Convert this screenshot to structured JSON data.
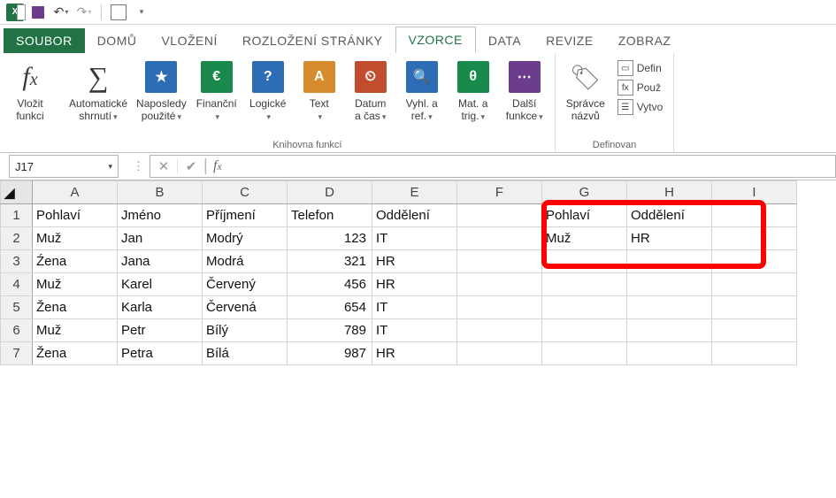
{
  "qat": {
    "undo": "↶",
    "redo": "↷"
  },
  "tabs": {
    "file": "SOUBOR",
    "home": "DOMŮ",
    "insert": "VLOŽENÍ",
    "layout": "ROZLOŽENÍ STRÁNKY",
    "formulas": "VZORCE",
    "data": "DATA",
    "review": "REVIZE",
    "view": "ZOBRAZ"
  },
  "ribbon": {
    "insert_fn": {
      "label": "Vložit\nfunkci"
    },
    "library_group": "Knihovna funkcí",
    "autosum": {
      "label": "Automatické\nshrnutí"
    },
    "recent": {
      "label": "Naposledy\npoužité",
      "icon": "★"
    },
    "financial": {
      "label": "Finanční",
      "icon": "€"
    },
    "logical": {
      "label": "Logické",
      "icon": "?"
    },
    "text": {
      "label": "Text",
      "icon": "A"
    },
    "date": {
      "label": "Datum\na čas",
      "icon": "⏲"
    },
    "lookup": {
      "label": "Vyhl. a\nref.",
      "icon": "🔍"
    },
    "math": {
      "label": "Mat. a\ntrig.",
      "icon": "θ"
    },
    "more": {
      "label": "Další\nfunkce",
      "icon": "⋯"
    },
    "names_group": "Definovan",
    "name_mgr": {
      "label": "Správce\nnázvů"
    },
    "def_name": "Defin",
    "use_in": "Použ",
    "create": "Vytvo"
  },
  "namebox": "J17",
  "formula": "",
  "cols": [
    "A",
    "B",
    "C",
    "D",
    "E",
    "F",
    "G",
    "H",
    "I"
  ],
  "rows": [
    {
      "n": "1",
      "c": [
        "Pohlaví",
        "Jméno",
        "Příjmení",
        "Telefon",
        "Oddělení",
        "",
        "Pohlaví",
        "Oddělení",
        ""
      ]
    },
    {
      "n": "2",
      "c": [
        "Muž",
        "Jan",
        "Modrý",
        "123",
        "IT",
        "",
        "Muž",
        "HR",
        ""
      ]
    },
    {
      "n": "3",
      "c": [
        "Źena",
        "Jana",
        "Modrá",
        "321",
        "HR",
        "",
        "",
        "",
        ""
      ]
    },
    {
      "n": "4",
      "c": [
        "Muž",
        "Karel",
        "Červený",
        "456",
        "HR",
        "",
        "",
        "",
        ""
      ]
    },
    {
      "n": "5",
      "c": [
        "Žena",
        "Karla",
        "Červená",
        "654",
        "IT",
        "",
        "",
        "",
        ""
      ]
    },
    {
      "n": "6",
      "c": [
        "Muž",
        "Petr",
        "Bílý",
        "789",
        "IT",
        "",
        "",
        "",
        ""
      ]
    },
    {
      "n": "7",
      "c": [
        "Žena",
        "Petra",
        "Bílá",
        "987",
        "HR",
        "",
        "",
        "",
        ""
      ]
    }
  ]
}
